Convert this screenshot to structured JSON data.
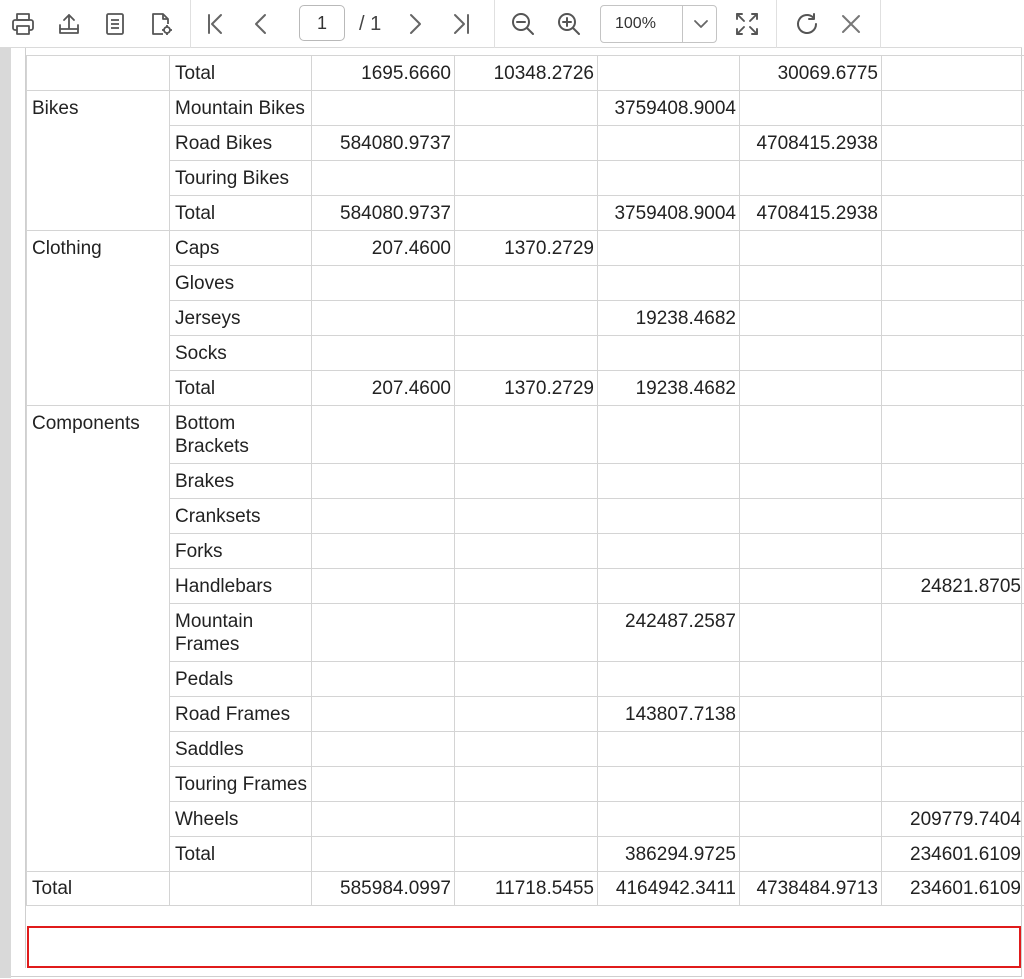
{
  "toolbar": {
    "page_number": "1",
    "page_total": "/ 1",
    "zoom": "100%",
    "icons": [
      "print-icon",
      "export-icon",
      "page-setup-icon",
      "print-layout-icon",
      "first-page-icon",
      "previous-page-icon",
      "next-page-icon",
      "last-page-icon",
      "zoom-out-icon",
      "zoom-in-icon",
      "zoom-dropdown-icon",
      "fit-page-icon",
      "refresh-icon",
      "close-icon"
    ]
  },
  "report": {
    "rows": [
      {
        "cat": "",
        "sub": "Total",
        "v": [
          "1695.6660",
          "10348.2726",
          "",
          "30069.6775",
          ""
        ]
      },
      {
        "cat": "Bikes",
        "sub": "Mountain Bikes",
        "v": [
          "",
          "",
          "3759408.9004",
          "",
          ""
        ]
      },
      {
        "cat": "",
        "sub": "Road Bikes",
        "v": [
          "584080.9737",
          "",
          "",
          "4708415.2938",
          ""
        ]
      },
      {
        "cat": "",
        "sub": "Touring Bikes",
        "v": [
          "",
          "",
          "",
          "",
          ""
        ]
      },
      {
        "cat": "",
        "sub": "Total",
        "v": [
          "584080.9737",
          "",
          "3759408.9004",
          "4708415.2938",
          ""
        ]
      },
      {
        "cat": "Clothing",
        "sub": "Caps",
        "v": [
          "207.4600",
          "1370.2729",
          "",
          "",
          ""
        ]
      },
      {
        "cat": "",
        "sub": "Gloves",
        "v": [
          "",
          "",
          "",
          "",
          ""
        ]
      },
      {
        "cat": "",
        "sub": "Jerseys",
        "v": [
          "",
          "",
          "19238.4682",
          "",
          ""
        ]
      },
      {
        "cat": "",
        "sub": "Socks",
        "v": [
          "",
          "",
          "",
          "",
          ""
        ]
      },
      {
        "cat": "",
        "sub": "Total",
        "v": [
          "207.4600",
          "1370.2729",
          "19238.4682",
          "",
          ""
        ]
      },
      {
        "cat": "Components",
        "sub": "Bottom Brackets",
        "v": [
          "",
          "",
          "",
          "",
          ""
        ]
      },
      {
        "cat": "",
        "sub": "Brakes",
        "v": [
          "",
          "",
          "",
          "",
          ""
        ]
      },
      {
        "cat": "",
        "sub": "Cranksets",
        "v": [
          "",
          "",
          "",
          "",
          ""
        ]
      },
      {
        "cat": "",
        "sub": "Forks",
        "v": [
          "",
          "",
          "",
          "",
          ""
        ]
      },
      {
        "cat": "",
        "sub": "Handlebars",
        "v": [
          "",
          "",
          "",
          "",
          "24821.8705"
        ]
      },
      {
        "cat": "",
        "sub": "Mountain Frames",
        "v": [
          "",
          "",
          "242487.2587",
          "",
          ""
        ]
      },
      {
        "cat": "",
        "sub": "Pedals",
        "v": [
          "",
          "",
          "",
          "",
          ""
        ]
      },
      {
        "cat": "",
        "sub": "Road Frames",
        "v": [
          "",
          "",
          "143807.7138",
          "",
          ""
        ]
      },
      {
        "cat": "",
        "sub": "Saddles",
        "v": [
          "",
          "",
          "",
          "",
          ""
        ]
      },
      {
        "cat": "",
        "sub": "Touring Frames",
        "v": [
          "",
          "",
          "",
          "",
          ""
        ]
      },
      {
        "cat": "",
        "sub": "Wheels",
        "v": [
          "",
          "",
          "",
          "",
          "209779.7404"
        ]
      },
      {
        "cat": "",
        "sub": "Total",
        "v": [
          "",
          "",
          "386294.9725",
          "",
          "234601.6109"
        ]
      }
    ],
    "grand_total": {
      "label": "Total",
      "sub": "",
      "v": [
        "585984.0997",
        "11718.5455",
        "4164942.3411",
        "4738484.9713",
        "234601.6109"
      ]
    },
    "highlight_color": "#e01b1b"
  }
}
